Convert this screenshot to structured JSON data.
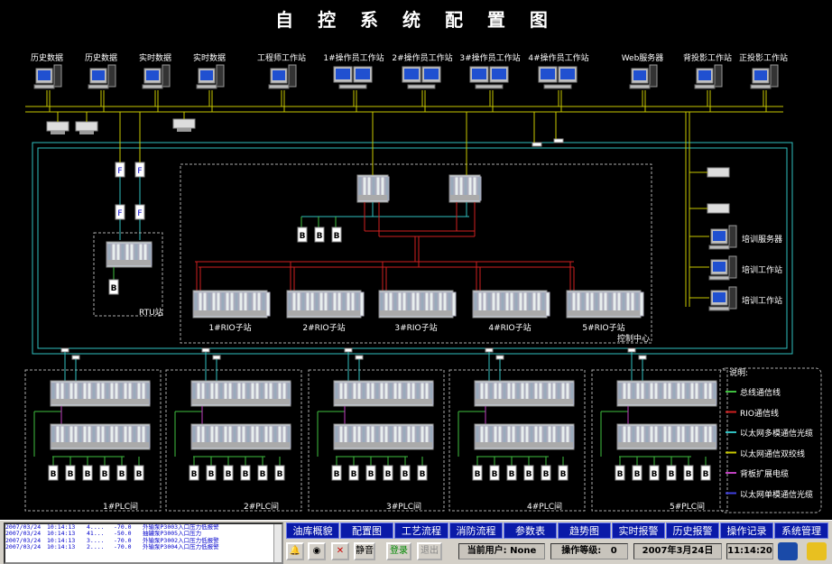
{
  "title": "自 控 系 统 配 置 图",
  "top_stations": [
    {
      "label": "历史数据",
      "type": "pc"
    },
    {
      "label": "历史数据",
      "type": "pc"
    },
    {
      "label": "实时数据",
      "type": "pc"
    },
    {
      "label": "实时数据",
      "type": "pc"
    },
    {
      "label": "工程师工作站",
      "type": "pc"
    },
    {
      "label": "1#操作员工作站",
      "type": "dual"
    },
    {
      "label": "2#操作员工作站",
      "type": "dual"
    },
    {
      "label": "3#操作员工作站",
      "type": "dual"
    },
    {
      "label": "4#操作员工作站",
      "type": "dual"
    },
    {
      "label": "Web服务器",
      "type": "pc"
    },
    {
      "label": "背投影工作站",
      "type": "pc"
    },
    {
      "label": "正投影工作站",
      "type": "pc"
    }
  ],
  "training": [
    {
      "label": "培训服务器"
    },
    {
      "label": "培训工作站"
    },
    {
      "label": "培训工作站"
    }
  ],
  "rio_stations": [
    "1#RIO子站",
    "2#RIO子站",
    "3#RIO子站",
    "4#RIO子站",
    "5#RIO子站"
  ],
  "control_center_label": "控制中心",
  "rtu_label": "RTU站",
  "plc_rooms": [
    "1#PLC间",
    "2#PLC间",
    "3#PLC间",
    "4#PLC间",
    "5#PLC间"
  ],
  "legend": {
    "title": "说明:",
    "items": [
      {
        "label": "总线通信线",
        "color": "#3fbf3f"
      },
      {
        "label": "RIO通信线",
        "color": "#d02020"
      },
      {
        "label": "以太网多模通信光缆",
        "color": "#30c0c0"
      },
      {
        "label": "以太网通信双绞线",
        "color": "#c8c800"
      },
      {
        "label": "背板扩展电缆",
        "color": "#c040c0"
      },
      {
        "label": "以太网单模通信光缆",
        "color": "#4040e0"
      }
    ]
  },
  "alarms": [
    {
      "date": "2007/03/24",
      "time": "10:14:13",
      "id": "4....",
      "value": "-70.0",
      "msg": "外输泵P3003入口压力低报警"
    },
    {
      "date": "2007/03/24",
      "time": "10:14:13",
      "id": "41...",
      "value": "-50.0",
      "msg": "抽罐泵P3005入口压力"
    },
    {
      "date": "2007/03/24",
      "time": "10:14:13",
      "id": "3....",
      "value": "-70.0",
      "msg": "外输泵P3002入口压力低报警"
    },
    {
      "date": "2007/03/24",
      "time": "10:14:13",
      "id": "2....",
      "value": "-70.0",
      "msg": "外输泵P3004入口压力低报警"
    }
  ],
  "nav": [
    "油库概貌",
    "配置图",
    "工艺流程",
    "消防流程",
    "参数表",
    "趋势图",
    "实时报警",
    "历史报警",
    "操作记录",
    "系统管理"
  ],
  "tools": {
    "mute": "静音",
    "login": "登录",
    "logout": "退出"
  },
  "status": {
    "user_label": "当前用户:",
    "user": "None",
    "level_label": "操作等级:",
    "level": "0",
    "date": "2007年3月24日",
    "time": "11:14:20"
  },
  "fiber_label": "F",
  "b_label": "B"
}
